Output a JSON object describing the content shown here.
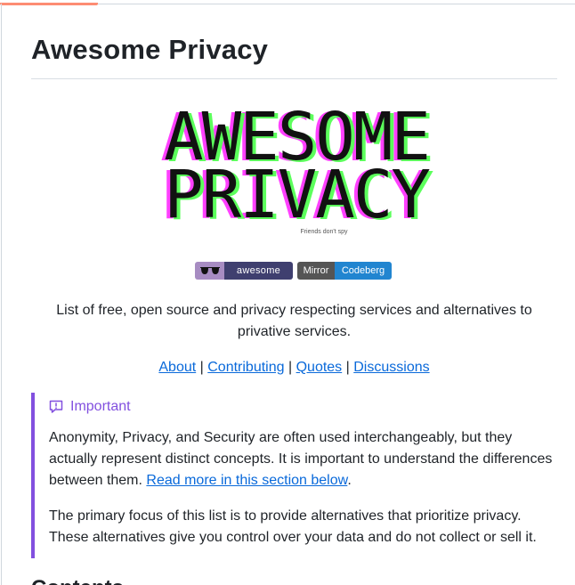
{
  "page": {
    "title": "Awesome Privacy",
    "logo": {
      "line1": "AWESOME",
      "line2": "PRIVACY",
      "tagline": "Friends don't spy"
    },
    "badges": {
      "awesome": {
        "icon": "sunglasses-icon",
        "label": "awesome"
      },
      "mirror": {
        "label": "Mirror",
        "value": "Codeberg"
      }
    },
    "description": "List of free, open source and privacy respecting services and alternatives to privative services.",
    "links": [
      {
        "label": "About"
      },
      {
        "label": "Contributing"
      },
      {
        "label": "Quotes"
      },
      {
        "label": "Discussions"
      }
    ],
    "link_separator": "|",
    "callout": {
      "type": "Important",
      "icon": "report-icon",
      "paragraph1_text": "Anonymity, Privacy, and Security are often used interchangeably, but they actually represent distinct concepts. It is important to understand the differences between them. ",
      "paragraph1_link": "Read more in this section below",
      "paragraph1_end": ".",
      "paragraph2": "The primary focus of this list is to provide alternatives that prioritize privacy. These alternatives give you control over your data and do not collect or sell it."
    },
    "next_heading": "Contents"
  },
  "colors": {
    "accent_tab": "#fd8c73",
    "link": "#0969da",
    "important": "#8250df",
    "logo_green": "#5cff5c",
    "logo_magenta": "#ff40ff",
    "badge_purple": "#a78cc2",
    "badge_navy": "#3f3f6f",
    "badge_gray": "#555555",
    "badge_blue": "#2185d0"
  }
}
